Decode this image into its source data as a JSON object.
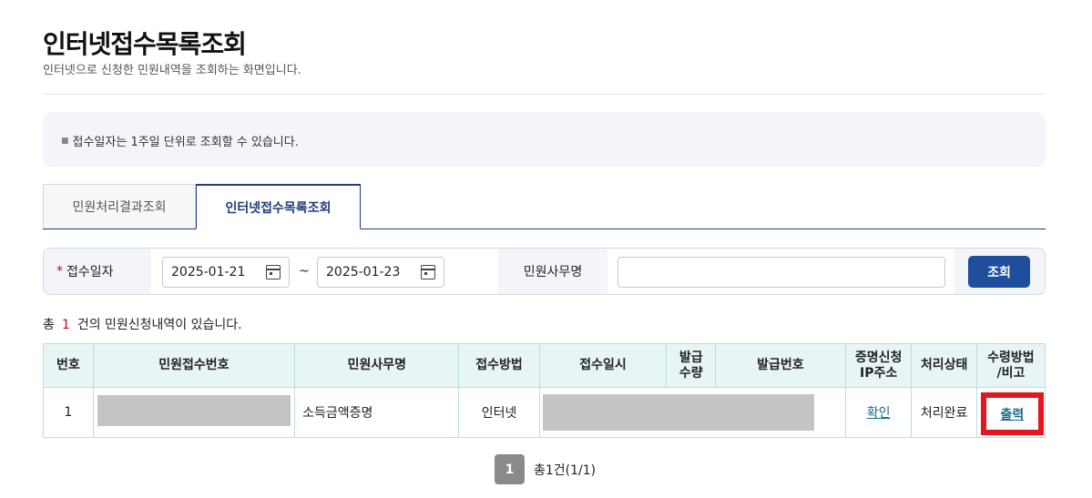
{
  "header": {
    "title": "인터넷접수목록조회",
    "description": "인터넷으로 신청한 민원내역을 조회하는 화면입니다."
  },
  "notice": {
    "text": "접수일자는 1주일 단위로 조회할 수 있습니다."
  },
  "tabs": [
    {
      "label": "민원처리결과조회",
      "active": false
    },
    {
      "label": "인터넷접수목록조회",
      "active": true
    }
  ],
  "search": {
    "date_label": "접수일자",
    "required_mark": "*",
    "date_from": "2025-01-21",
    "date_separator": "~",
    "date_to": "2025-01-23",
    "office_label": "민원사무명",
    "office_value": "",
    "search_button": "조회"
  },
  "result": {
    "prefix": "총",
    "count": "1",
    "suffix": "건의 민원신청내역이 있습니다."
  },
  "table": {
    "headers": {
      "no": "번호",
      "receipt_no": "민원접수번호",
      "office_name": "민원사무명",
      "method": "접수방법",
      "datetime": "접수일시",
      "qty_line1": "발급",
      "qty_line2": "수량",
      "issue_no": "발급번호",
      "ip_line1": "증명신청",
      "ip_line2": "IP주소",
      "status": "처리상태",
      "receive_line1": "수령방법",
      "receive_line2": "/비고"
    },
    "rows": [
      {
        "no": "1",
        "office_name": "소득금액증명",
        "method": "인터넷",
        "ip_link": "확인",
        "status": "처리완료",
        "receive_link": "출력"
      }
    ]
  },
  "pagination": {
    "current": "1",
    "summary": "총1건(1/1)"
  },
  "colors": {
    "primary": "#1f4e9c",
    "tab_active": "#1f3d7a",
    "table_header_bg": "#e8f5f5",
    "highlight": "#e3151f",
    "required": "#d0021b"
  }
}
